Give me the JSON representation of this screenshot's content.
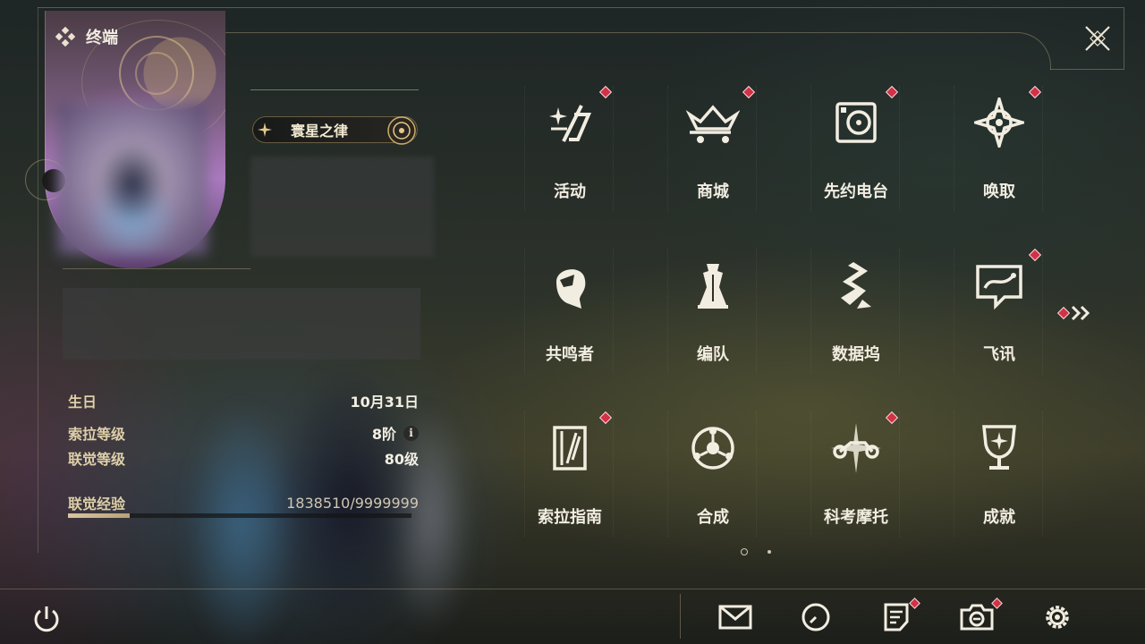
{
  "header": {
    "title": "终端"
  },
  "profile": {
    "title_badge": "寰星之律",
    "stats": [
      {
        "label": "生日",
        "value": "10月31日"
      },
      {
        "label": "索拉等级",
        "value": "8阶"
      },
      {
        "label": "联觉等级",
        "value": "80级"
      },
      {
        "label": "联觉经验",
        "value": "1838510/9999999"
      }
    ],
    "exp_fraction": 0.18
  },
  "menu": {
    "items": [
      {
        "label": "活动",
        "icon": "event-icon",
        "badge": true
      },
      {
        "label": "商城",
        "icon": "shop-crown-cart-icon",
        "badge": true
      },
      {
        "label": "先约电台",
        "icon": "radio-icon",
        "badge": true
      },
      {
        "label": "唤取",
        "icon": "convene-star-icon",
        "badge": true
      },
      {
        "label": "共鸣者",
        "icon": "resonator-head-icon",
        "badge": false
      },
      {
        "label": "编队",
        "icon": "team-chess-icon",
        "badge": false
      },
      {
        "label": "数据坞",
        "icon": "data-bank-icon",
        "badge": false
      },
      {
        "label": "飞讯",
        "icon": "chat-bubble-icon",
        "badge": true
      },
      {
        "label": "索拉指南",
        "icon": "guidebook-icon",
        "badge": true
      },
      {
        "label": "合成",
        "icon": "synthesis-icon",
        "badge": false
      },
      {
        "label": "科考摩托",
        "icon": "motorbike-icon",
        "badge": true
      },
      {
        "label": "成就",
        "icon": "trophy-icon",
        "badge": false
      }
    ],
    "page": 1,
    "page_count": 2
  },
  "colors": {
    "accent_gold": "#d8c6a0",
    "badge_red": "#d23246",
    "text_light": "#f2ede1"
  }
}
